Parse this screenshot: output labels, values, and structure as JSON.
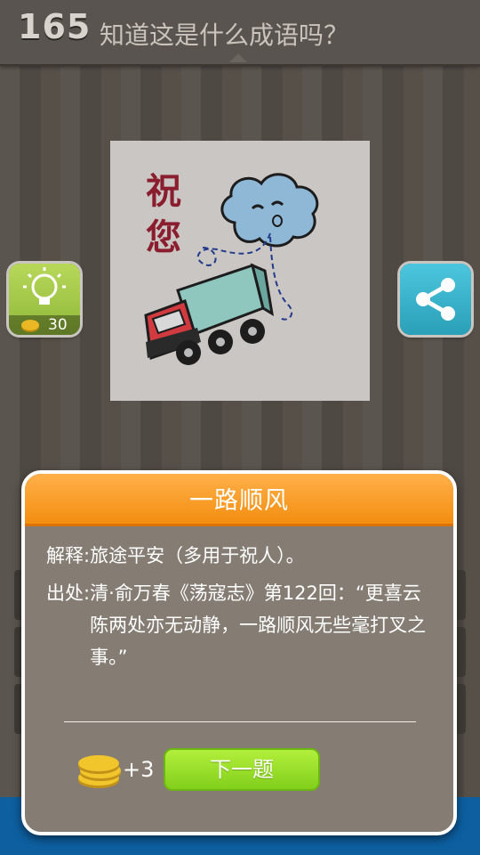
{
  "header": {
    "level_number": "165",
    "question": "知道这是什么成语吗？"
  },
  "puzzle": {
    "image_text": "祝您",
    "description_icons": [
      "cloud-icon",
      "truck-icon"
    ]
  },
  "hint": {
    "cost": "30",
    "icon": "lightbulb-icon"
  },
  "share": {
    "icon": "share-icon"
  },
  "dialog": {
    "title": "一路顺风",
    "explanation_label": "解释:",
    "explanation_text": "旅途平安（多用于祝人）。",
    "source_label": "出处:",
    "source_text": "清·俞万春《荡寇志》第122回：“更喜云陈两处亦无动静，一路顺风无些毫打叉之事。”",
    "reward": "+3",
    "next_button": "下一题"
  },
  "colors": {
    "title_bar": "#f38e10",
    "next_button": "#82cf1c",
    "dialog_bg": "#857c74"
  }
}
